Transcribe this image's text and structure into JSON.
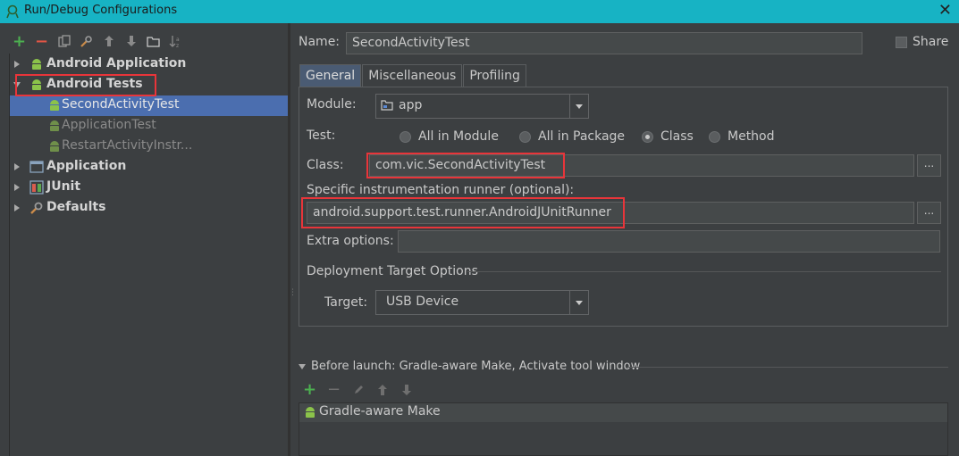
{
  "window": {
    "title": "Run/Debug Configurations"
  },
  "left_toolbar": {
    "icons": [
      "add-icon",
      "remove-icon",
      "copy-icon",
      "settings-icon",
      "move-up-icon",
      "move-down-icon",
      "folder-icon",
      "sort-icon"
    ]
  },
  "tree": {
    "items": [
      {
        "label": "Android Application",
        "level": 0,
        "expanded": false,
        "bold": true,
        "icon": "android-icon"
      },
      {
        "label": "Android Tests",
        "level": 0,
        "expanded": true,
        "bold": true,
        "icon": "android-icon",
        "highlighted": true
      },
      {
        "label": "SecondActivityTest",
        "level": 1,
        "selected": true,
        "icon": "android-test-icon"
      },
      {
        "label": "ApplicationTest",
        "level": 1,
        "dim": true,
        "icon": "android-test-icon"
      },
      {
        "label": "RestartActivityInstr...",
        "level": 1,
        "dim": true,
        "icon": "android-test-icon"
      },
      {
        "label": "Application",
        "level": 0,
        "expanded": false,
        "bold": true,
        "icon": "application-icon"
      },
      {
        "label": "JUnit",
        "level": 0,
        "expanded": false,
        "bold": true,
        "icon": "junit-icon"
      },
      {
        "label": "Defaults",
        "level": 0,
        "expanded": false,
        "bold": true,
        "icon": "defaults-icon"
      }
    ]
  },
  "form": {
    "name_label": "Name:",
    "name_value": "SecondActivityTest",
    "share_label": "Share",
    "share_checked": false,
    "tabs": [
      "General",
      "Miscellaneous",
      "Profiling"
    ],
    "active_tab": "General",
    "module_label": "Module:",
    "module_value": "app",
    "test_label": "Test:",
    "test_options": [
      "All in Module",
      "All in Package",
      "Class",
      "Method"
    ],
    "test_selected": "Class",
    "class_label": "Class:",
    "class_value": "com.vic.SecondActivityTest",
    "runner_label": "Specific instrumentation runner (optional):",
    "runner_value": "android.support.test.runner.AndroidJUnitRunner",
    "extra_label": "Extra options:",
    "extra_value": "",
    "deployment_label": "Deployment Target Options",
    "target_label": "Target:",
    "target_value": "USB Device",
    "browse_label": "..."
  },
  "before_launch": {
    "header": "Before launch: Gradle-aware Make, Activate tool window",
    "items": [
      "Gradle-aware Make"
    ]
  },
  "colors": {
    "titlebar": "#17b3c4",
    "selection": "#4b6eaf",
    "highlight": "#e8353a",
    "android_green": "#8bc34a"
  }
}
